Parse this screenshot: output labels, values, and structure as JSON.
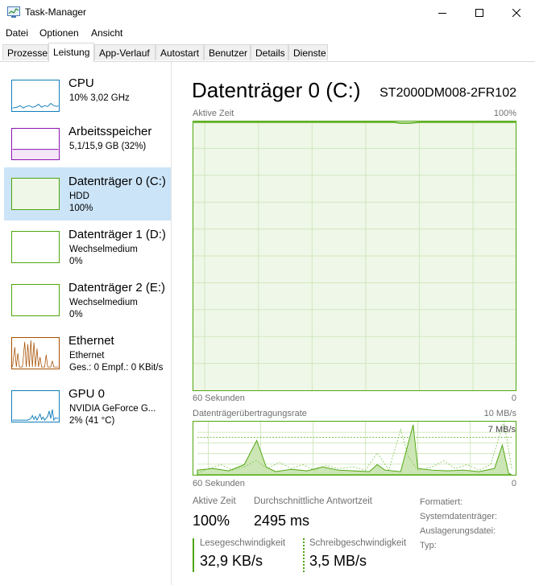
{
  "window": {
    "title": "Task-Manager"
  },
  "menu": [
    "Datei",
    "Optionen",
    "Ansicht"
  ],
  "tabs": [
    "Prozesse",
    "Leistung",
    "App-Verlauf",
    "Autostart",
    "Benutzer",
    "Details",
    "Dienste"
  ],
  "active_tab": "Leistung",
  "sidebar": {
    "items": [
      {
        "title": "CPU",
        "sub1": "10% 3,02 GHz",
        "sub2": ""
      },
      {
        "title": "Arbeitsspeicher",
        "sub1": "5,1/15,9 GB (32%)",
        "sub2": ""
      },
      {
        "title": "Datenträger 0 (C:)",
        "sub1": "HDD",
        "sub2": "100%"
      },
      {
        "title": "Datenträger 1 (D:)",
        "sub1": "Wechselmedium",
        "sub2": "0%"
      },
      {
        "title": "Datenträger 2 (E:)",
        "sub1": "Wechselmedium",
        "sub2": "0%"
      },
      {
        "title": "Ethernet",
        "sub1": "Ethernet",
        "sub2": "Ges.: 0 Empf.: 0 KBit/s"
      },
      {
        "title": "GPU 0",
        "sub1": "NVIDIA GeForce G...",
        "sub2": "2% (41 °C)"
      }
    ],
    "selected_index": 2
  },
  "main": {
    "title": "Datenträger 0 (C:)",
    "model": "ST2000DM008-2FR102",
    "graph1": {
      "label": "Aktive Zeit",
      "max_label": "100%",
      "time_label": "60 Sekunden",
      "min_label": "0"
    },
    "graph2": {
      "label": "Datenträgerübertragungsrate",
      "max_label": "10 MB/s",
      "marker_label": "7 MB/s",
      "time_label": "60 Sekunden",
      "min_label": "0"
    },
    "stats": {
      "active_time_label": "Aktive Zeit",
      "active_time_value": "100%",
      "avg_response_label": "Durchschnittliche Antwortzeit",
      "avg_response_value": "2495 ms",
      "read_label": "Lesegeschwindigkeit",
      "read_value": "32,9 KB/s",
      "write_label": "Schreibgeschwindigkeit",
      "write_value": "3,5 MB/s"
    },
    "details": [
      "Formatiert:",
      "Systemdatenträger:",
      "Auslagerungsdatei:",
      "Typ:"
    ]
  },
  "colors": {
    "disk": "#4da60c",
    "cpu": "#117dbb",
    "memory": "#8b12ae",
    "ethernet": "#a74f01",
    "selected": "#cce4f7"
  }
}
